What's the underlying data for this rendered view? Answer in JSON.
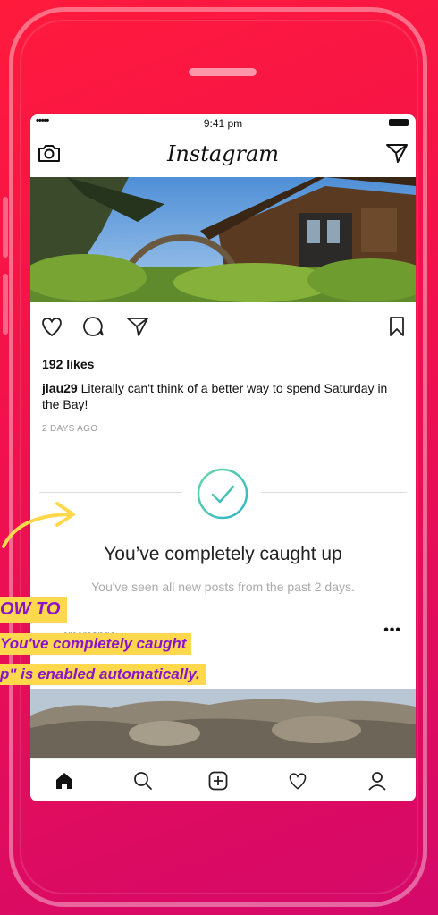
{
  "status_bar": {
    "time": "9:41 pm",
    "signal": "•••••"
  },
  "app": {
    "title": "Instagram"
  },
  "post": {
    "likes": "192 likes",
    "username": "jlau29",
    "caption": "Literally can't think of a better way to spend Saturday in the Bay!",
    "date": "2 DAYS AGO"
  },
  "caught_up": {
    "title": "You’ve completely caught up",
    "subtitle": "You've seen all new posts from the past 2 days."
  },
  "next_post": {
    "username": "cmercango",
    "more": "•••"
  },
  "overlay": {
    "howto": "OW TO",
    "line1": "You've completely caught",
    "line2": "p\" is enabled automatically."
  },
  "colors": {
    "accent_check": "#3ec1b4",
    "highlight": "#ffd84d",
    "highlight_text": "#8a14c9",
    "background": "#f0104e"
  },
  "icons": [
    "camera-icon",
    "direct-message-icon",
    "heart-icon",
    "comment-icon",
    "share-icon",
    "bookmark-icon",
    "check-circle-icon",
    "home-icon",
    "search-icon",
    "add-post-icon",
    "activity-icon",
    "profile-icon",
    "arrow-icon"
  ]
}
